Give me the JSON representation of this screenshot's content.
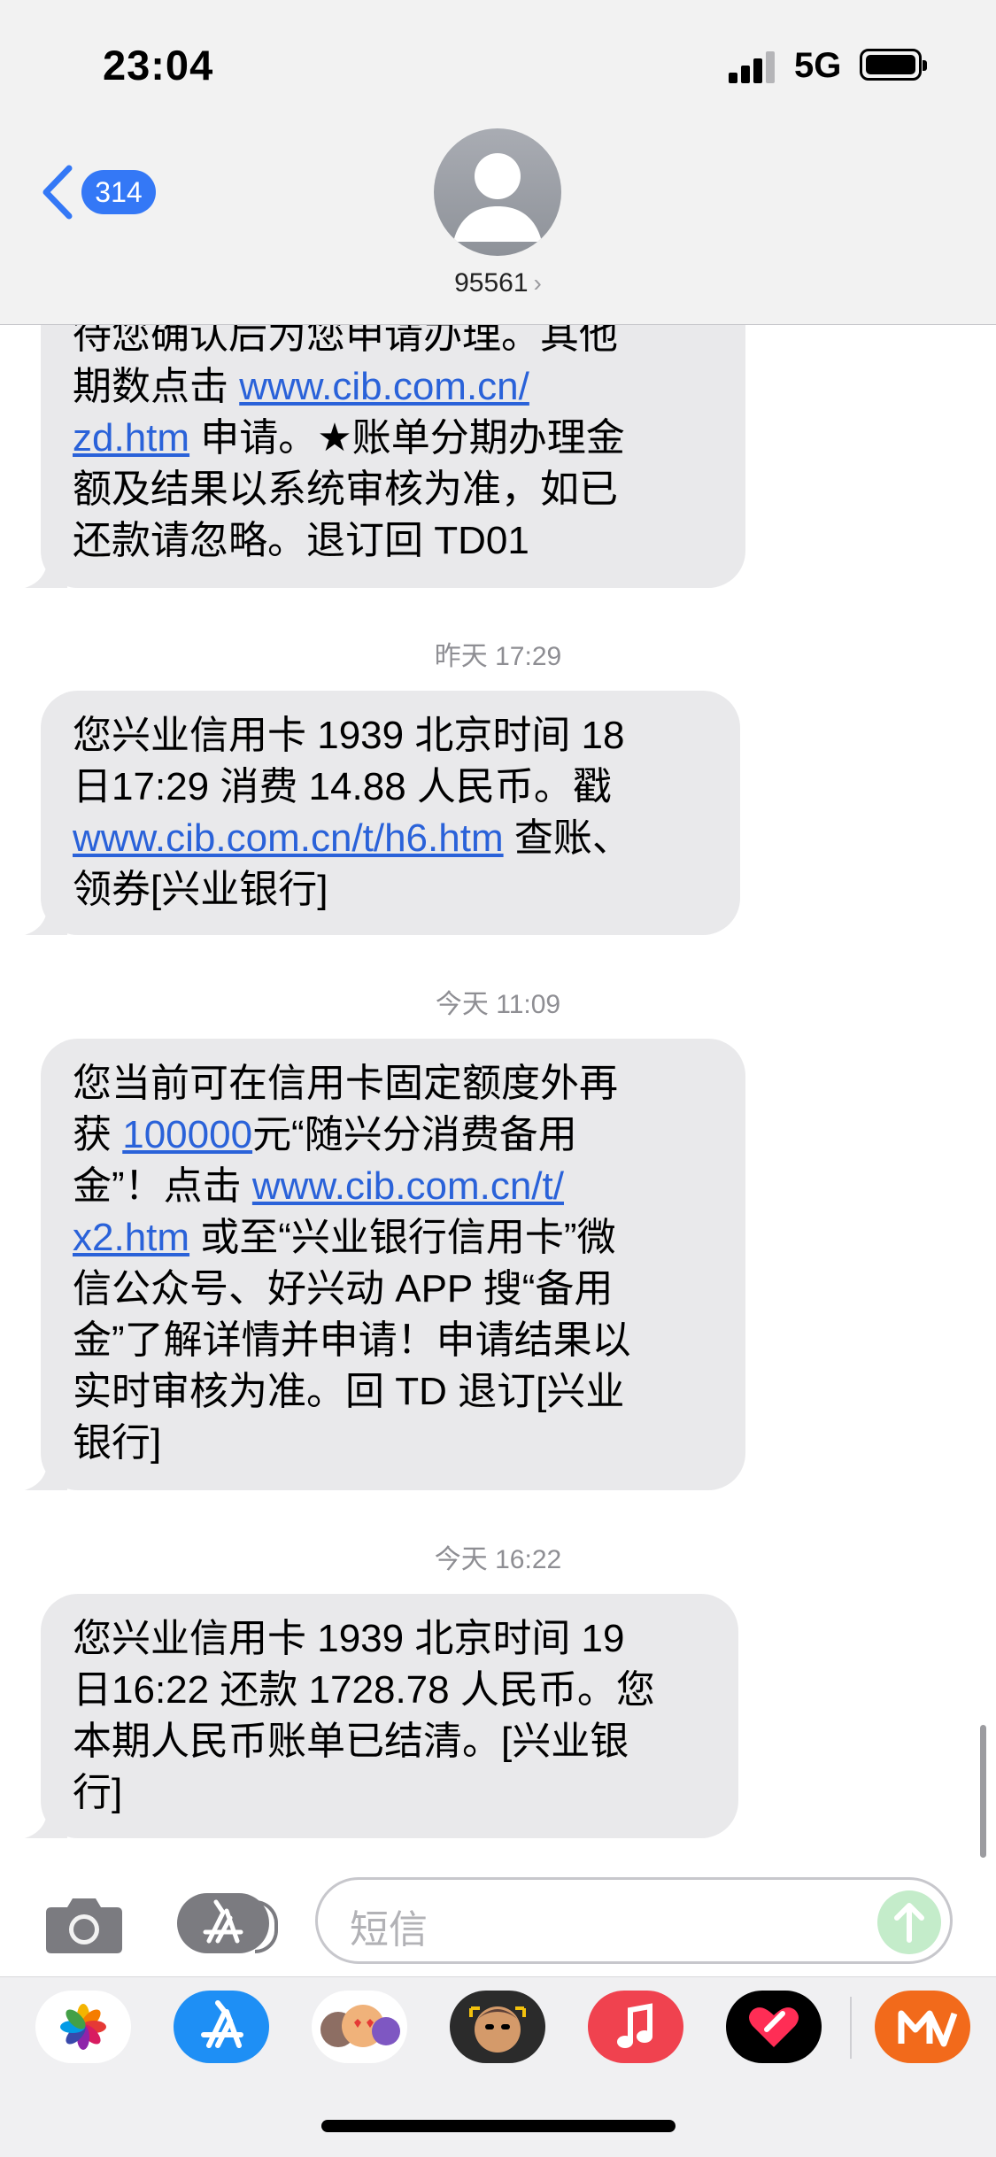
{
  "status": {
    "time": "23:04",
    "network": "5G"
  },
  "header": {
    "back_count": "314",
    "contact": "95561",
    "contact_chevron": "›"
  },
  "messages": [
    {
      "lines": [
        "待您确认后为您申请办理。其他",
        "期数点击 ",
        "www.cib.com.cn/",
        "zd.htm",
        " 申请。★账单分期办理金",
        "额及结果以系统审核为准，如已",
        "还款请忽略。退订回 TD01"
      ]
    },
    {
      "timestamp": "昨天 17:29",
      "text_a": "您兴业信用卡 1939 北京时间 18",
      "text_b": "日17:29 消费 14.88 人民币。戳",
      "link": "www.cib.com.cn/t/h6.htm",
      "text_c": " 查账、",
      "text_d": "领券[兴业银行]"
    },
    {
      "timestamp": "今天 11:09",
      "l1": "您当前可在信用卡固定额度外再",
      "l2a": "获 ",
      "amount": "100000",
      "l2b": "元“随兴分消费备用",
      "l3a": "金”！点击 ",
      "link1": "www.cib.com.cn/t/",
      "link2": "x2.htm",
      "l4b": " 或至“兴业银行信用卡”微",
      "l5": "信公众号、好兴动 APP 搜“备用",
      "l6": "金”了解详情并申请！申请结果以",
      "l7": "实时审核为准。回 TD 退订[兴业",
      "l8": "银行]"
    },
    {
      "timestamp": "今天 16:22",
      "l1": "您兴业信用卡 1939 北京时间 19",
      "l2": "日16:22 还款 1728.78 人民币。您",
      "l3": "本期人民币账单已结清。[兴业银",
      "l4": "行]"
    }
  ],
  "input": {
    "placeholder": "短信"
  },
  "colors": {
    "bubble": "#e9e9eb",
    "link": "#2a62d9",
    "accent": "#3478f6",
    "send_disabled": "#c4ecca"
  },
  "dock": {
    "icons": [
      "photos-app-icon",
      "app-store-icon",
      "memoji-stickers-icon",
      "memoji-icon",
      "music-app-icon",
      "digital-touch-icon",
      "mango-tv-icon"
    ]
  }
}
